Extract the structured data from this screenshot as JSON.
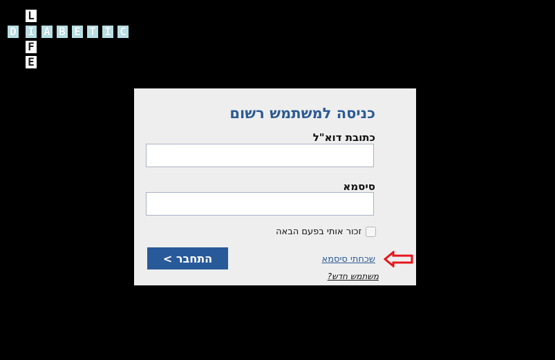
{
  "logo": {
    "vertical_letters": [
      "L",
      "I",
      "F",
      "E"
    ],
    "horizontal_letters": [
      "D",
      "I",
      "A",
      "B",
      "E",
      "T",
      "I",
      "C"
    ]
  },
  "login": {
    "title": "כניסה למשתמש רשום",
    "email_label": "כתובת דוא\"ל",
    "email_value": "",
    "password_label": "סיסמא",
    "password_value": "",
    "remember_label": "זכור אותי בפעם הבאה",
    "remember_checked": false,
    "login_button": "התחבר >",
    "forgot_link": "שכחתי סיסמא",
    "new_user_link": "משתמש חדש?"
  },
  "colors": {
    "page_background": "#000000",
    "panel_background": "#eeeeee",
    "accent_blue": "#285a99",
    "annotation_red": "#e8141b"
  },
  "annotation": {
    "icon": "red-arrow-icon",
    "points_to": "forgot_link"
  }
}
